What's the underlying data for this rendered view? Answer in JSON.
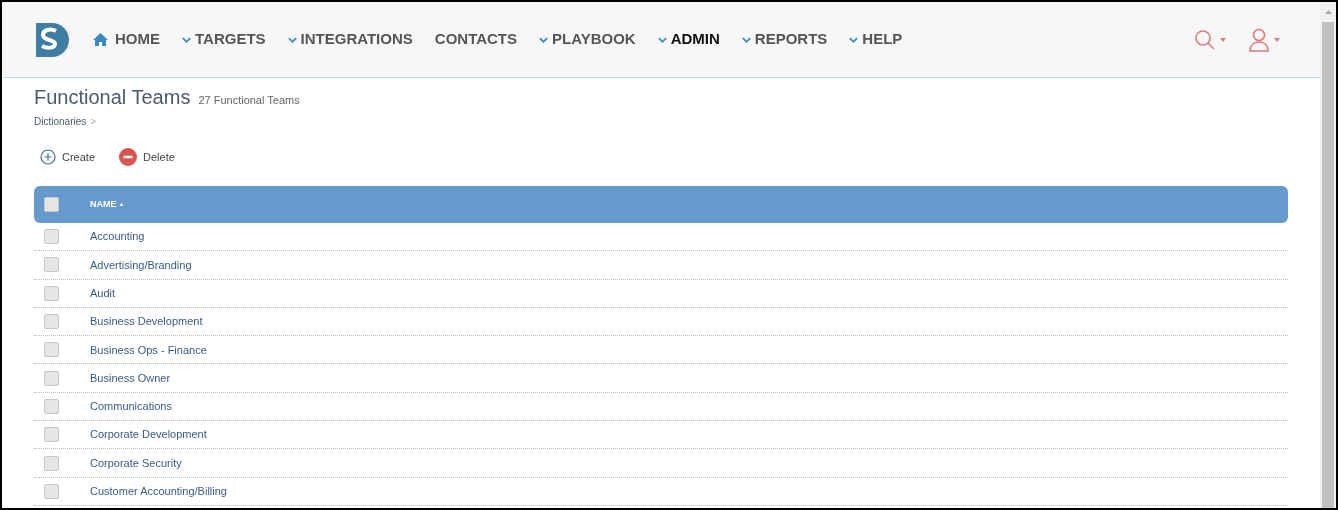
{
  "nav": {
    "items": [
      {
        "label": "HOME",
        "kind": "home",
        "selected": false
      },
      {
        "label": "TARGETS",
        "kind": "dropdown",
        "selected": false
      },
      {
        "label": "INTEGRATIONS",
        "kind": "dropdown",
        "selected": false
      },
      {
        "label": "CONTACTS",
        "kind": "link",
        "selected": false
      },
      {
        "label": "PLAYBOOK",
        "kind": "dropdown",
        "selected": false
      },
      {
        "label": "ADMIN",
        "kind": "dropdown",
        "selected": true
      },
      {
        "label": "REPORTS",
        "kind": "dropdown",
        "selected": false
      },
      {
        "label": "HELP",
        "kind": "dropdown",
        "selected": false
      }
    ]
  },
  "page": {
    "title": "Functional Teams",
    "count": "27 Functional Teams",
    "breadcrumb": "Dictionaries",
    "breadcrumb_separator": ">"
  },
  "toolbar": [
    {
      "label": "Create",
      "kind": "create"
    },
    {
      "label": "Delete",
      "kind": "delete"
    }
  ],
  "table": {
    "header": {
      "label": "NAME",
      "sort": "▲",
      "checked": false
    },
    "rows": [
      {
        "name": "Accounting",
        "checked": false
      },
      {
        "name": "Advertising/Branding",
        "checked": false
      },
      {
        "name": "Audit",
        "checked": false
      },
      {
        "name": "Business Development",
        "checked": false
      },
      {
        "name": "Business Ops - Finance",
        "checked": false
      },
      {
        "name": "Business Owner",
        "checked": false
      },
      {
        "name": "Communications",
        "checked": false
      },
      {
        "name": "Corporate Development",
        "checked": false
      },
      {
        "name": "Corporate Security",
        "checked": false
      },
      {
        "name": "Customer Accounting/Billing",
        "checked": false
      }
    ]
  }
}
